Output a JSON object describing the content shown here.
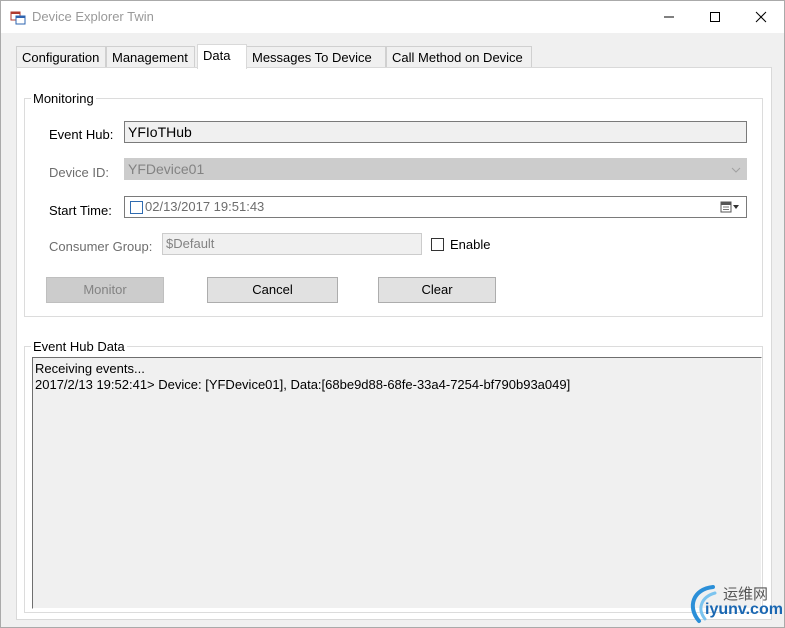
{
  "window": {
    "title": "Device Explorer Twin"
  },
  "tabs": [
    {
      "label": "Configuration"
    },
    {
      "label": "Management"
    },
    {
      "label": "Data"
    },
    {
      "label": "Messages To Device"
    },
    {
      "label": "Call Method on Device"
    }
  ],
  "active_tab": "Data",
  "monitoring": {
    "group_label": "Monitoring",
    "event_hub_label": "Event Hub:",
    "event_hub_value": "YFIoTHub",
    "device_id_label": "Device ID:",
    "device_id_value": "YFDevice01",
    "start_time_label": "Start Time:",
    "start_time_value": "02/13/2017 19:51:43",
    "consumer_group_label": "Consumer Group:",
    "consumer_group_value": "$Default",
    "enable_label": "Enable",
    "enable_checked": false,
    "monitor_button": "Monitor",
    "cancel_button": "Cancel",
    "clear_button": "Clear"
  },
  "event_hub_data": {
    "group_label": "Event Hub Data",
    "lines": [
      "Receiving events...",
      "2017/2/13 19:52:41> Device: [YFDevice01], Data:[68be9d88-68fe-33a4-7254-bf790b93a049]"
    ]
  },
  "watermark": {
    "cn": "运维网",
    "en": "iyunv.com"
  },
  "colors": {
    "window_bg": "#f0f0f0",
    "panel_bg": "#ffffff",
    "disabled_bg": "#cccccc",
    "accent_blue": "#1a67b2"
  }
}
